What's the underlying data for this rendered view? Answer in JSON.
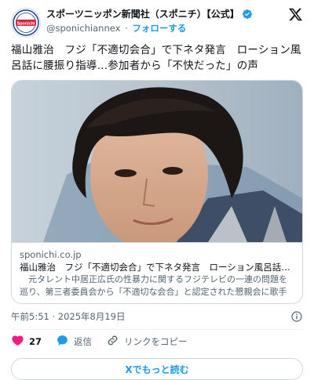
{
  "account": {
    "display_name": "スポーツニッポン新聞社（スポニチ）【公式】",
    "handle": "@sponichiannex",
    "separator": "·",
    "follow_label": "フォローする",
    "avatar_text": "Sponichi"
  },
  "tweet": {
    "text": "福山雅治　フジ「不適切会合」で下ネタ発言　ローション風呂話に腰振り指導…参加者から「不快だった」の声"
  },
  "card": {
    "domain": "sponichi.co.jp",
    "title": "福山雅治　フジ「不適切会合」で下ネタ発言　ローション風呂話に腰...",
    "description": "　元タレント中居正広氏の性暴力に関するフジテレビの一連の問題を巡り、第三者委員会から「不適切な会合」と認定された懇親会に歌手で..."
  },
  "timestamp": "午前5:51 · 2025年8月19日",
  "actions": {
    "likes": "27",
    "reply_label": "返信",
    "copy_link_label": "リンクをコピー"
  },
  "read_more_label": "Xでもっと読む",
  "icons": {
    "verified": "verified-badge-icon",
    "x_logo": "x-logo-icon",
    "info": "info-icon",
    "like": "heart-icon",
    "reply": "reply-bubble-icon",
    "link": "link-icon"
  },
  "colors": {
    "accent": "#1d9bf0",
    "like": "#f91880",
    "text": "#0f1419",
    "secondary": "#536471"
  }
}
